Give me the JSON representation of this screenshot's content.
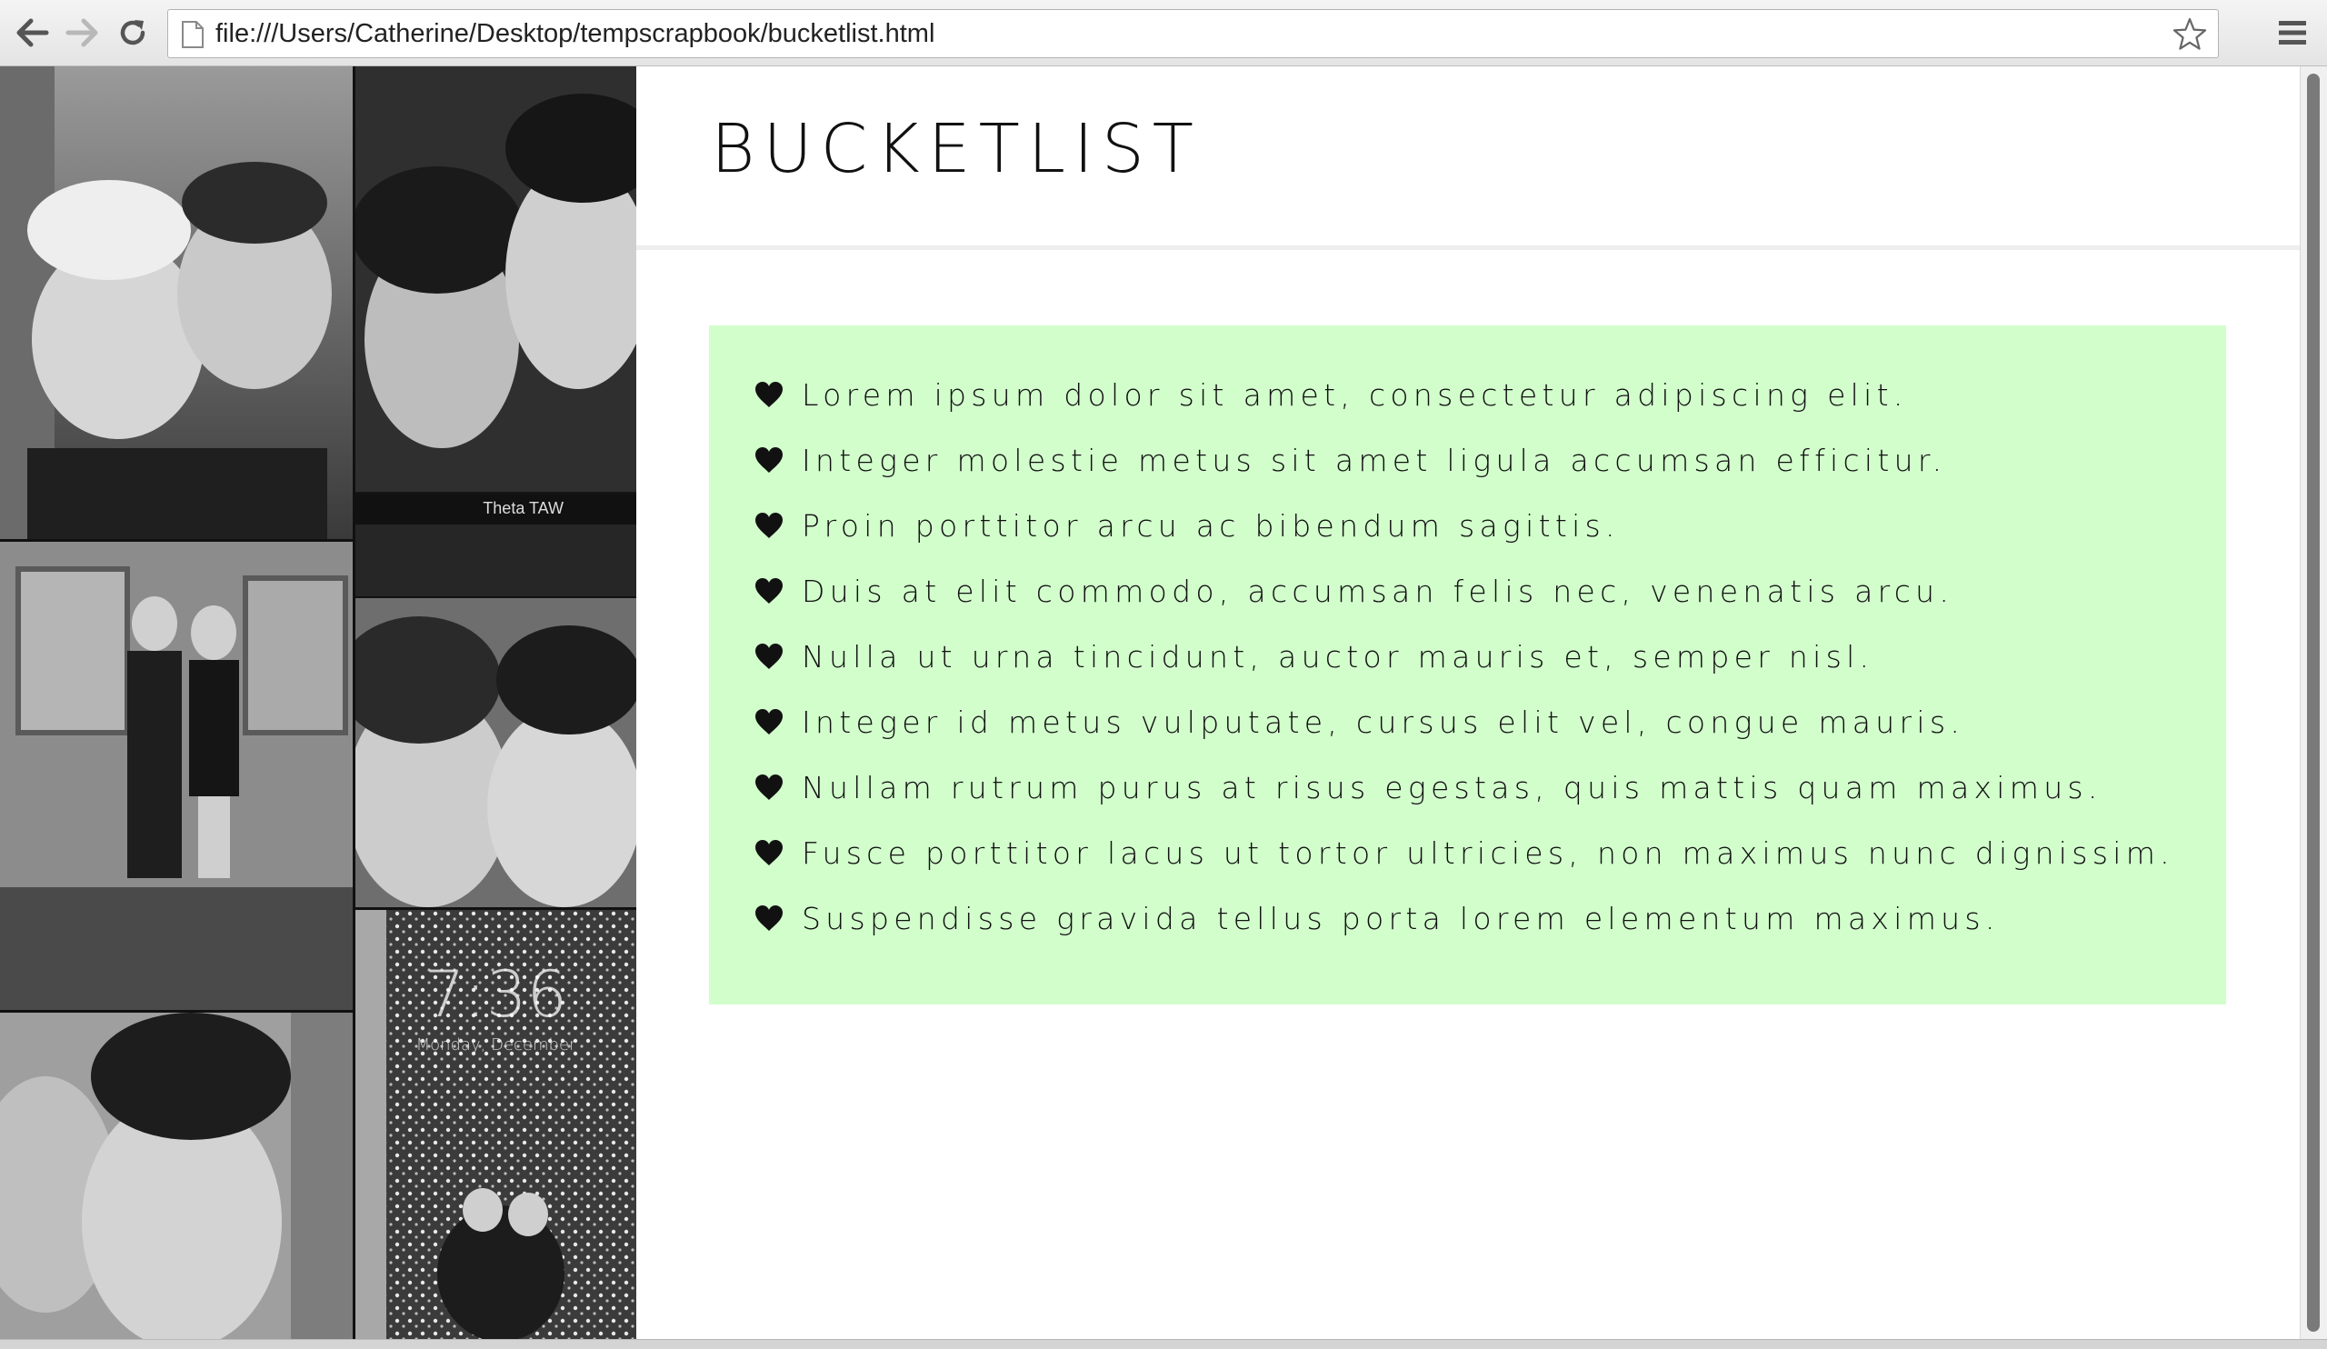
{
  "browser": {
    "url": "file:///Users/Catherine/Desktop/tempscrapbook/bucketlist.html",
    "icons": [
      "back-arrow-icon",
      "forward-arrow-icon",
      "reload-icon",
      "page-icon",
      "star-icon",
      "menu-icon"
    ]
  },
  "collage": {
    "caption": "Theta TAW",
    "lockscreen_time": "7:36",
    "lockscreen_date": "Monday, December"
  },
  "page": {
    "title": "BUCKETLIST"
  },
  "bucketlist": {
    "background": "#d2fecc",
    "items": [
      "Lorem ipsum dolor sit amet, consectetur adipiscing elit.",
      "Integer molestie metus sit amet ligula accumsan efficitur.",
      "Proin porttitor arcu ac bibendum sagittis.",
      "Duis at elit commodo, accumsan felis nec, venenatis arcu.",
      "Nulla ut urna tincidunt, auctor mauris et, semper nisl.",
      "Integer id metus vulputate, cursus elit vel, congue mauris.",
      "Nullam rutrum purus at risus egestas, quis mattis quam maximus.",
      "Fusce porttitor lacus ut tortor ultricies, non maximus nunc dignissim.",
      "Suspendisse gravida tellus porta lorem elementum maximus."
    ]
  }
}
